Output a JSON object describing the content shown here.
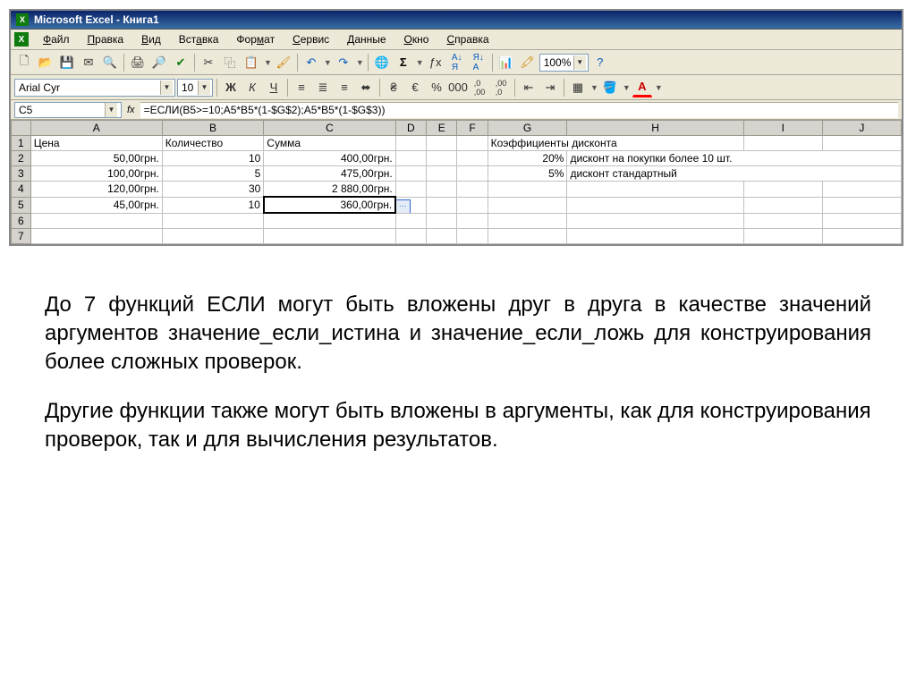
{
  "title": "Microsoft Excel - Книга1",
  "menu": {
    "file": "Файл",
    "edit": "Правка",
    "view": "Вид",
    "insert": "Вставка",
    "format": "Формат",
    "tools": "Сервис",
    "data": "Данные",
    "window": "Окно",
    "help": "Справка"
  },
  "format": {
    "font_name": "Arial Cyr",
    "font_size": "10",
    "bold": "Ж",
    "italic": "К",
    "underline": "Ч"
  },
  "zoom": "100%",
  "name_box": "C5",
  "fx_label": "fx",
  "formula": "=ЕСЛИ(B5>=10;A5*B5*(1-$G$2);A5*B5*(1-$G$3))",
  "columns": [
    "A",
    "B",
    "C",
    "D",
    "E",
    "F",
    "G",
    "H",
    "I",
    "J"
  ],
  "rows": [
    "1",
    "2",
    "3",
    "4",
    "5",
    "6",
    "7"
  ],
  "cells": {
    "A1": "Цена",
    "B1": "Количество",
    "C1": "Сумма",
    "G1": "Коэффициенты дисконта",
    "A2": "50,00грн.",
    "B2": "10",
    "C2": "400,00грн.",
    "G2": "20%",
    "H2": "дисконт на покупки более 10 шт.",
    "A3": "100,00грн.",
    "B3": "5",
    "C3": "475,00грн.",
    "G3": "5%",
    "H3": "дисконт стандартный",
    "A4": "120,00грн.",
    "B4": "30",
    "C4": "2 880,00грн.",
    "A5": "45,00грн.",
    "B5": "10",
    "C5": "360,00грн."
  },
  "paragraphs": {
    "p1": "До 7 функций ЕСЛИ могут быть вложены друг в друга в качестве значений аргументов значение_если_истина и значение_если_ложь для конструирования более сложных проверок.",
    "p2": "Другие функции также могут быть вложены в аргументы, как для конструирования проверок, так и для вычисления результатов."
  }
}
